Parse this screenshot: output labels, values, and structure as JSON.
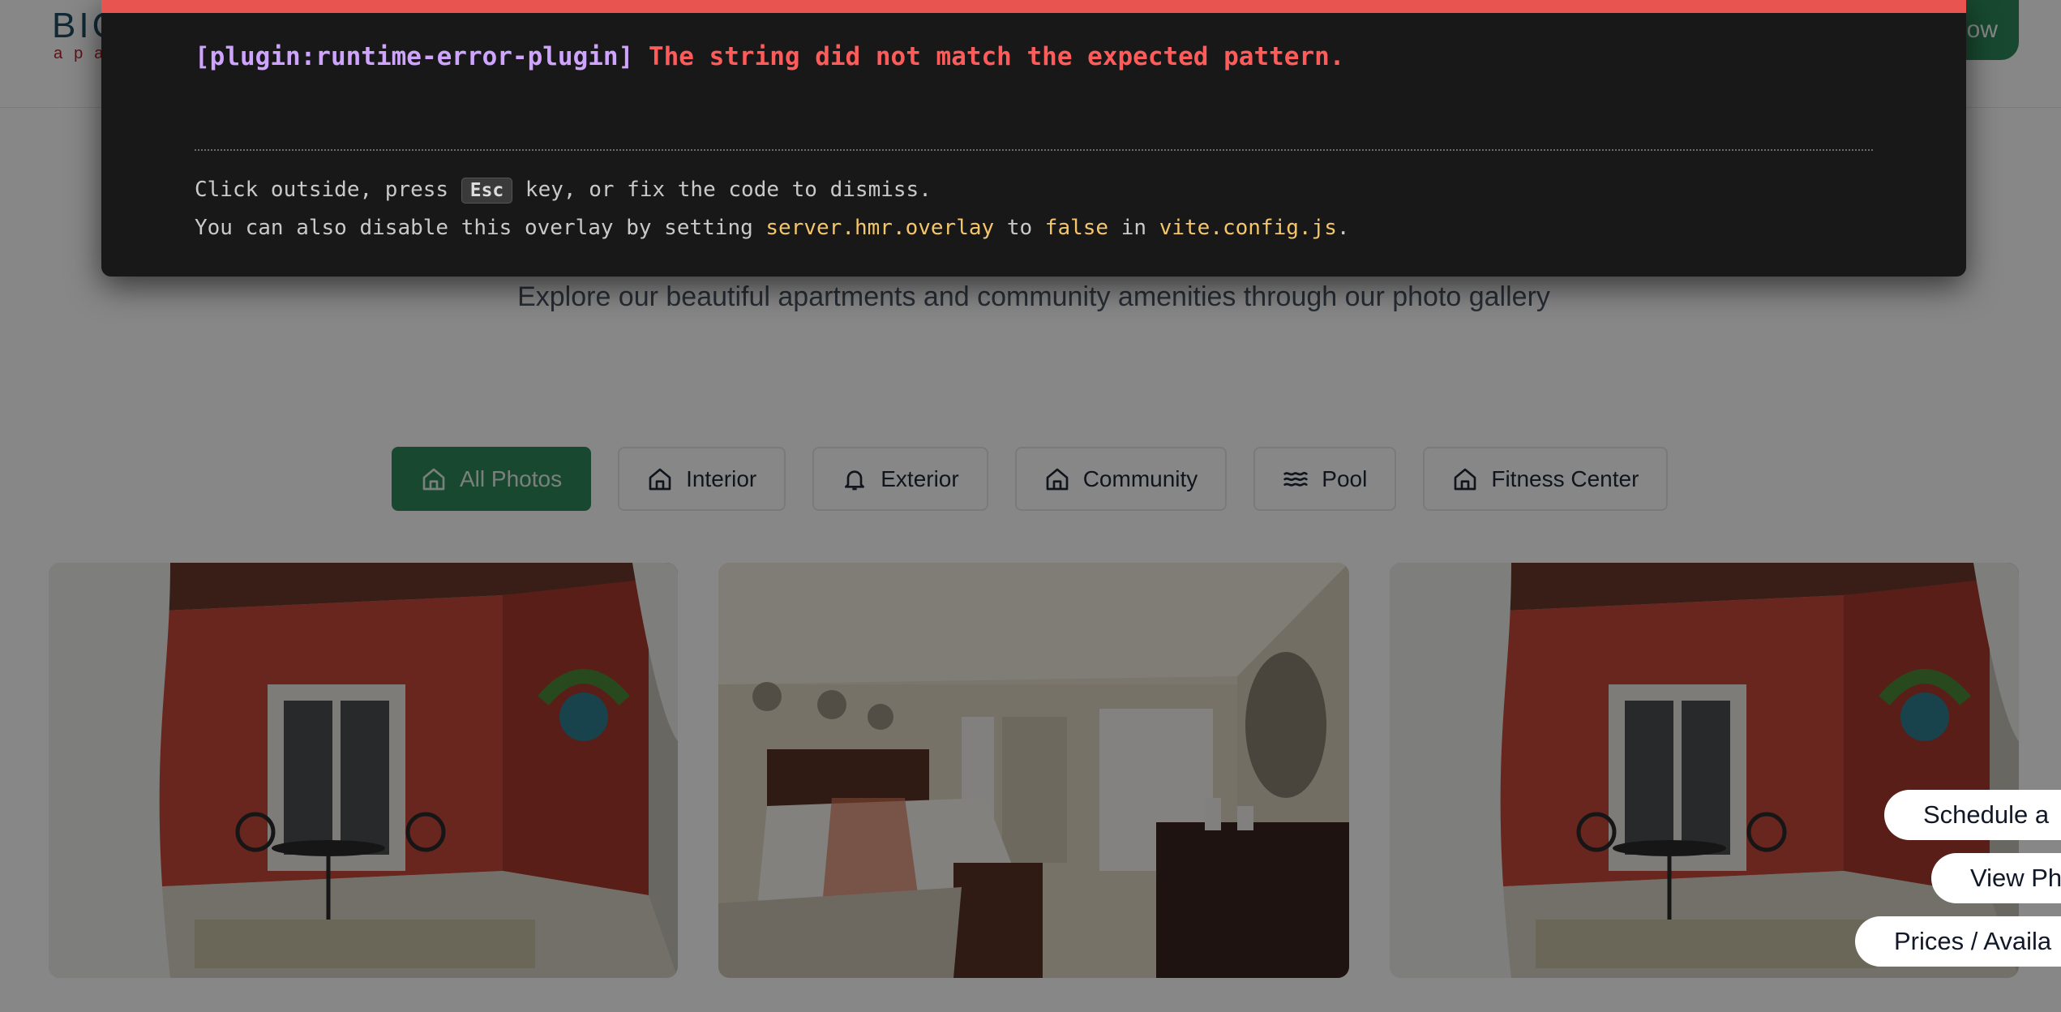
{
  "header": {
    "logo_main": "BIG",
    "logo_sub": "apar",
    "cta_label": "ow"
  },
  "gallery": {
    "subtitle": "Explore our beautiful apartments and community amenities through our photo gallery"
  },
  "filters": [
    {
      "label": "All Photos",
      "icon": "home-icon",
      "active": true
    },
    {
      "label": "Interior",
      "icon": "home-icon",
      "active": false
    },
    {
      "label": "Exterior",
      "icon": "bell-icon",
      "active": false
    },
    {
      "label": "Community",
      "icon": "home-icon",
      "active": false
    },
    {
      "label": "Pool",
      "icon": "waves-icon",
      "active": false
    },
    {
      "label": "Fitness Center",
      "icon": "home-icon",
      "active": false
    }
  ],
  "photos": [
    {
      "subject": "patio"
    },
    {
      "subject": "bedroom"
    },
    {
      "subject": "patio"
    }
  ],
  "side_buttons": {
    "schedule": "Schedule a",
    "view_photos": "View Ph",
    "prices": "Prices / Availa"
  },
  "error_overlay": {
    "plugin": "[plugin:runtime-error-plugin]",
    "message": "The string did not match the expected pattern.",
    "tip_line1_before": "Click outside, press ",
    "tip_key": "Esc",
    "tip_line1_after": " key, or fix the code to dismiss.",
    "tip_line2_part1": "You can also disable this overlay by setting ",
    "tip_line2_code1": "server.hmr.overlay",
    "tip_line2_part2": " to ",
    "tip_line2_code2": "false",
    "tip_line2_part3": " in ",
    "tip_line2_code3": "vite.config.js",
    "tip_line2_part4": "."
  },
  "colors": {
    "accent": "#2f8a5b",
    "error_bar": "#e8544f",
    "overlay_bg": "#181818"
  }
}
